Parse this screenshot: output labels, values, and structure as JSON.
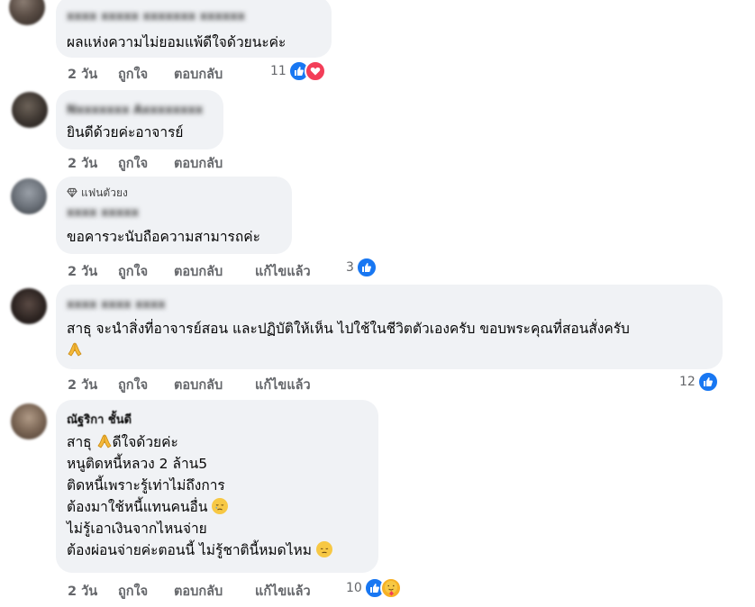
{
  "comments": [
    {
      "name": "xxxx xxxxx xxxxxxx xxxxxx",
      "lines": [
        "ผลแห่งความไม่ยอมแพ้ดีใจด้วยนะค่ะ"
      ],
      "time": "2 วัน",
      "like": "ถูกใจ",
      "reply": "ตอบกลับ",
      "edited": "",
      "reaction_count": "11",
      "reactions": [
        "like-icon",
        "love-icon"
      ]
    },
    {
      "name": "Nxxxxxxx Axxxxxxxx",
      "lines": [
        "ยินดีด้วยค่ะอาจารย์"
      ],
      "time": "2 วัน",
      "like": "ถูกใจ",
      "reply": "ตอบกลับ",
      "edited": "",
      "reaction_count": "",
      "reactions": []
    },
    {
      "badge": "แฟนตัวยง",
      "name": "xxxx xxxxx",
      "lines": [
        "ขอคารวะนับถือความสามารถค่ะ"
      ],
      "time": "2 วัน",
      "like": "ถูกใจ",
      "reply": "ตอบกลับ",
      "edited": "แก้ไขแล้ว",
      "reaction_count": "3",
      "reactions": [
        "like-icon"
      ]
    },
    {
      "name": "xxxx xxxx xxxx",
      "lines": [
        "สาธุ จะนำสิ่งที่อาจารย์สอน และปฏิบัติให้เห็น ไปใช้ในชีวิตตัวเองครับ ขอบพระคุณที่สอนสั่งครับ"
      ],
      "time": "2 วัน",
      "like": "ถูกใจ",
      "reply": "ตอบกลับ",
      "edited": "แก้ไขแล้ว",
      "reaction_count": "12",
      "reactions": [
        "like-icon"
      ]
    },
    {
      "name": "ณัฐริกา ชั้นดี",
      "lines": [
        "สาธุ",
        "ดีใจด้วยค่ะ",
        "หนูติดหนี้หลวง 2 ล้าน5",
        "ติดหนี้เพราะรู้เท่าไม่ถึงการ",
        "ต้องมาใช้หนี้แทนคนอื่น",
        "ไม่รู้เอาเงินจากไหนจ่าย",
        "ต้องผ่อนจ่ายค่ะตอนนี้ ไม่รู้ชาตินี้หมดไหม"
      ],
      "time": "2 วัน",
      "like": "ถูกใจ",
      "reply": "ตอบกลับ",
      "edited": "แก้ไขแล้ว",
      "reaction_count": "10",
      "reactions": [
        "like-icon",
        "care-icon"
      ]
    }
  ],
  "colors": {
    "like": "#1877f2",
    "love": "#f33e58",
    "care": "#f7b125",
    "bubble": "#f0f2f5",
    "meta": "#65676b"
  }
}
